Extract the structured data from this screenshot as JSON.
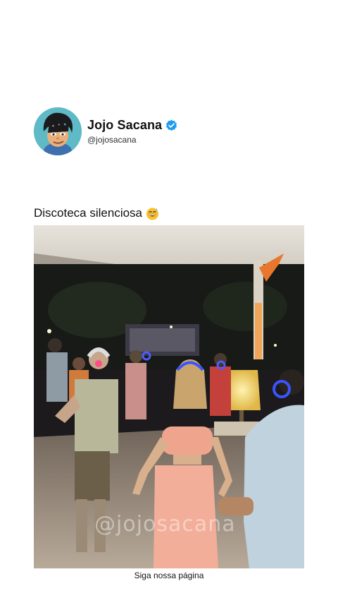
{
  "profile": {
    "display_name": "Jojo Sacana",
    "handle": "@jojosacana",
    "verified": true,
    "avatar_icon": "cartoon-boy-avatar",
    "verified_color": "#1d9bf0"
  },
  "post": {
    "caption": "Discoteca silenciosa",
    "caption_emoji": "grinning-sweat-emoji",
    "media_description_icon": "video-frame",
    "watermark": "@jojosacana"
  },
  "footer": {
    "text": "Siga nossa página"
  }
}
